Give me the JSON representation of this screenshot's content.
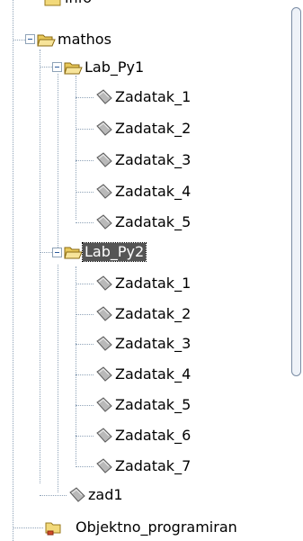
{
  "tree": {
    "top_node": {
      "label": "info",
      "icon": "folder-icon"
    },
    "mathos": {
      "label": "mathos",
      "icon": "folder-open-icon",
      "folders": [
        {
          "label": "Lab_Py1",
          "icon": "folder-open-icon",
          "items": [
            "Zadatak_1",
            "Zadatak_2",
            "Zadatak_3",
            "Zadatak_4",
            "Zadatak_5"
          ]
        },
        {
          "label": "Lab_Py2",
          "icon": "folder-open-icon",
          "selected": true,
          "items": [
            "Zadatak_1",
            "Zadatak_2",
            "Zadatak_3",
            "Zadatak_4",
            "Zadatak_5",
            "Zadatak_6",
            "Zadatak_7"
          ]
        }
      ],
      "file": {
        "label": "zad1",
        "icon": "document-icon"
      }
    },
    "bottom_node": {
      "label": "Objektno_programiran",
      "icon": "project-folder-icon"
    }
  },
  "colors": {
    "selection": "#555555",
    "folder": "#f2d97a",
    "tree_lines": "#8fa3b8"
  }
}
